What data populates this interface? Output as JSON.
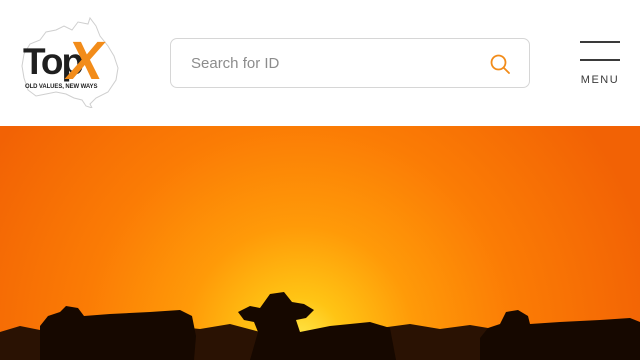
{
  "header": {
    "logo": {
      "word": "Top",
      "mark": "X",
      "tagline": "OLD VALUES, NEW WAYS"
    },
    "search": {
      "placeholder": "Search for ID",
      "icon": "search-icon"
    },
    "menu": {
      "label": "MENU",
      "icon": "hamburger-icon"
    }
  },
  "hero": {
    "image": "sunset-cattle-silhouette",
    "colors": {
      "sky_top": "#f56a05",
      "sun_glow": "#ffd21a",
      "silhouette": "#1a0a02"
    }
  },
  "colors": {
    "accent": "#f28c1a",
    "text_dark": "#1f1f1f"
  }
}
